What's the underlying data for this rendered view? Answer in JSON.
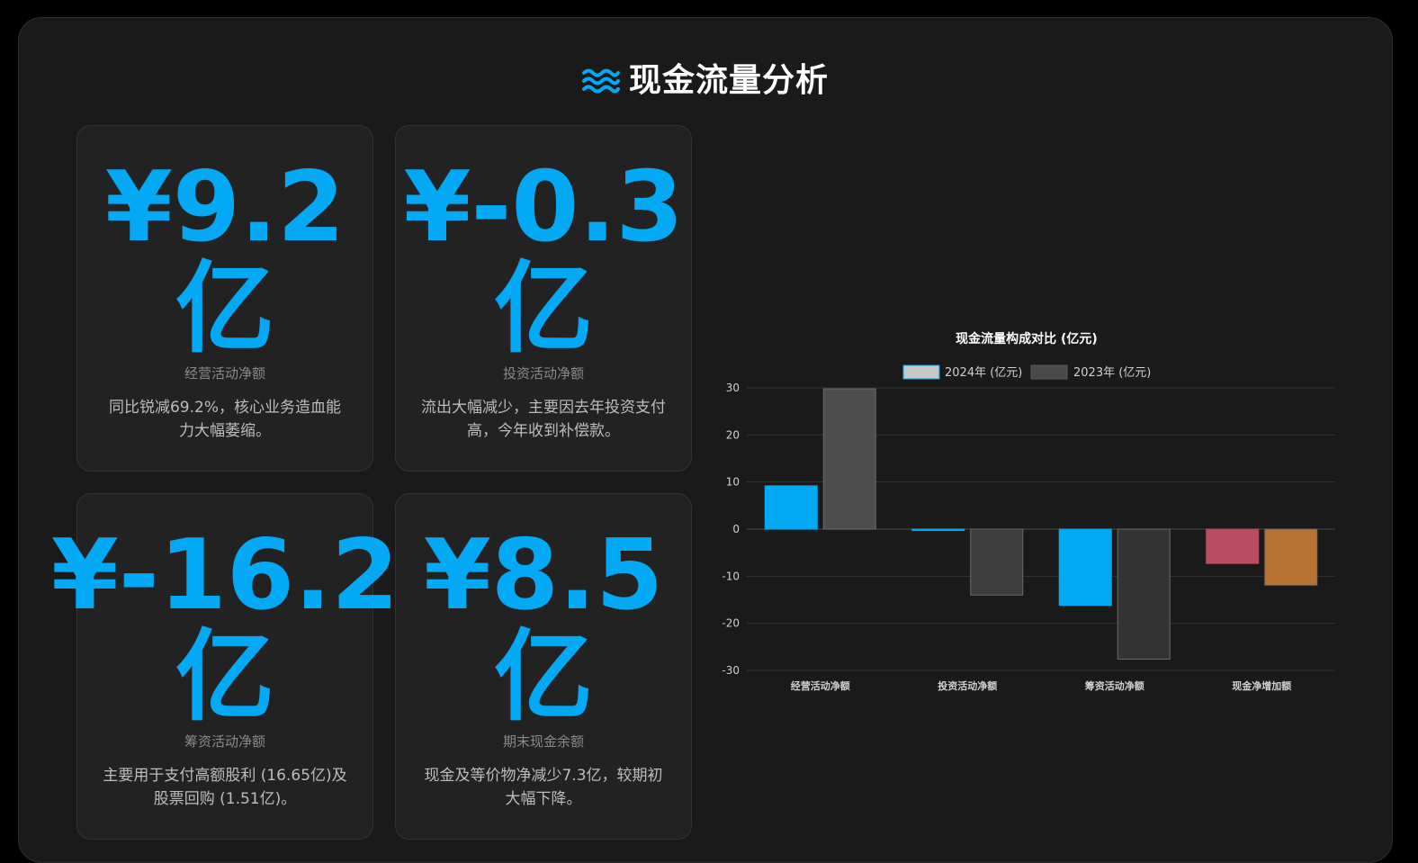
{
  "header": {
    "icon": "water-waves-icon",
    "title": "现金流量分析",
    "accent_color": "#03a9f4"
  },
  "cards": [
    {
      "value": "¥9.2",
      "unit": "亿",
      "label": "经营活动净额",
      "desc": "同比锐减69.2%，核心业务造血能力大幅萎缩。"
    },
    {
      "value": "¥-0.3",
      "unit": "亿",
      "label": "投资活动净额",
      "desc": "流出大幅减少，主要因去年投资支付高，今年收到补偿款。"
    },
    {
      "value": "¥-16.2",
      "unit": "亿",
      "label": "筹资活动净额",
      "desc": "主要用于支付高额股利 (16.65亿)及股票回购 (1.51亿)。"
    },
    {
      "value": "¥8.5",
      "unit": "亿",
      "label": "期末现金余额",
      "desc": "现金及等价物净减少7.3亿，较期初大幅下降。"
    }
  ],
  "chart_data": {
    "type": "bar",
    "title": "现金流量构成对比 (亿元)",
    "categories": [
      "经营活动净额",
      "投资活动净额",
      "筹资活动净额",
      "现金净增加额"
    ],
    "series": [
      {
        "name": "2024年 (亿元)",
        "values": [
          9.2,
          -0.3,
          -16.2,
          -7.3
        ],
        "colors": [
          "#03a9f4",
          "#03a9f4",
          "#03a9f4",
          "#b84c60"
        ],
        "legend_color": "#c8c8c8"
      },
      {
        "name": "2023年 (亿元)",
        "values": [
          29.8,
          -14,
          -27.6,
          -11.9
        ],
        "colors": [
          "#4d4d4d",
          "#3d3d3d",
          "#333333",
          "#b87333"
        ],
        "legend_color": "#4a4a4a"
      }
    ],
    "yticks": [
      30,
      20,
      10,
      0,
      -10,
      -20,
      -30
    ],
    "ylim": [
      -30,
      30
    ],
    "grid": true,
    "legend_position": "top"
  }
}
